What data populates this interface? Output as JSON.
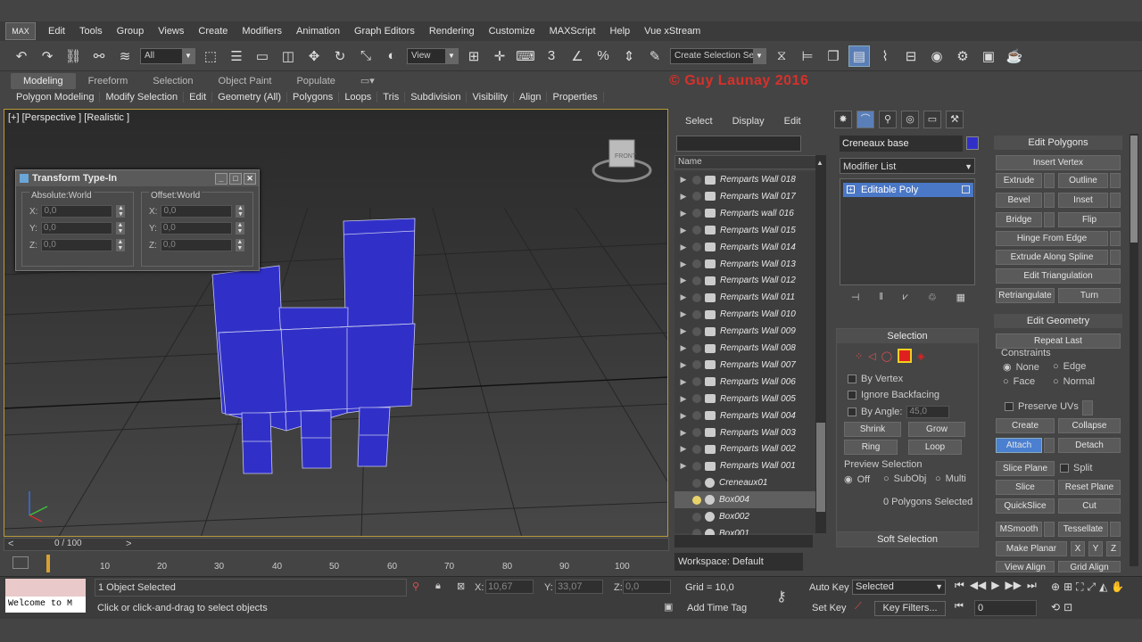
{
  "menubar": {
    "logo": "MAX",
    "items": [
      "Edit",
      "Tools",
      "Group",
      "Views",
      "Create",
      "Modifiers",
      "Animation",
      "Graph Editors",
      "Rendering",
      "Customize",
      "MAXScript",
      "Help",
      "Vue xStream"
    ]
  },
  "toolbar": {
    "filter_value": "All",
    "refcoord_value": "View",
    "selset_value": "Create Selection Se"
  },
  "ribbon": {
    "tabs": [
      "Modeling",
      "Freeform",
      "Selection",
      "Object Paint",
      "Populate"
    ],
    "subtabs": [
      "Polygon Modeling",
      "Modify Selection",
      "Edit",
      "Geometry (All)",
      "Polygons",
      "Loops",
      "Tris",
      "Subdivision",
      "Visibility",
      "Align",
      "Properties"
    ]
  },
  "watermark": "© Guy Launay 2016",
  "viewport": {
    "label": "[+] [Perspective ] [Realistic ]",
    "gizmo": "FRONT",
    "object_color": "#3030c8"
  },
  "transform_typein": {
    "title": "Transform Type-In",
    "absolute": {
      "title": "Absolute:World",
      "x": "0,0",
      "y": "0,0",
      "z": "0,0"
    },
    "offset": {
      "title": "Offset:World",
      "x": "0,0",
      "y": "0,0",
      "z": "0,0"
    },
    "axis_x": "X:",
    "axis_y": "Y:",
    "axis_z": "Z:"
  },
  "timeline": {
    "frame_label": "0 / 100",
    "ticks": [
      "10",
      "20",
      "30",
      "40",
      "50",
      "60",
      "70",
      "80",
      "90",
      "100"
    ]
  },
  "scene_explorer": {
    "tabs": [
      "Select",
      "Display",
      "Edit"
    ],
    "column": "Name",
    "items": [
      {
        "name": "Remparts Wall 018",
        "type": "group"
      },
      {
        "name": "Remparts Wall 017",
        "type": "group"
      },
      {
        "name": "Remparts wall 016",
        "type": "group"
      },
      {
        "name": "Remparts Wall 015",
        "type": "group"
      },
      {
        "name": "Remparts Wall 014",
        "type": "group"
      },
      {
        "name": "Remparts Wall 013",
        "type": "group"
      },
      {
        "name": "Remparts Wall 012",
        "type": "group"
      },
      {
        "name": "Remparts Wall 011",
        "type": "group"
      },
      {
        "name": "Remparts Wall 010",
        "type": "group"
      },
      {
        "name": "Remparts Wall 009",
        "type": "group"
      },
      {
        "name": "Remparts Wall 008",
        "type": "group"
      },
      {
        "name": "Remparts Wall 007",
        "type": "group"
      },
      {
        "name": "Remparts Wall 006",
        "type": "group"
      },
      {
        "name": "Remparts Wall 005",
        "type": "group"
      },
      {
        "name": "Remparts Wall 004",
        "type": "group"
      },
      {
        "name": "Remparts Wall 003",
        "type": "group"
      },
      {
        "name": "Remparts Wall 002",
        "type": "group"
      },
      {
        "name": "Remparts Wall 001",
        "type": "group"
      },
      {
        "name": "Creneaux01",
        "type": "object"
      },
      {
        "name": "Box004",
        "type": "object",
        "selected": true
      },
      {
        "name": "Box002",
        "type": "object"
      },
      {
        "name": "Box001",
        "type": "object"
      }
    ],
    "workspace": "Workspace: Default"
  },
  "command_panel": {
    "object_name": "Creneaux base",
    "modifier_list": "Modifier List",
    "stack_item": "Editable Poly",
    "selection": {
      "title": "Selection",
      "by_vertex": "By Vertex",
      "ignore_backfacing": "Ignore Backfacing",
      "by_angle": "By Angle:",
      "angle_value": "45,0",
      "shrink": "Shrink",
      "grow": "Grow",
      "ring": "Ring",
      "loop": "Loop",
      "preview_title": "Preview Selection",
      "preview_off": "Off",
      "preview_subobj": "SubObj",
      "preview_multi": "Multi",
      "status": "0 Polygons Selected"
    },
    "soft_selection": "Soft Selection"
  },
  "edit_polygons": {
    "title": "Edit Polygons",
    "insert_vertex": "Insert Vertex",
    "extrude": "Extrude",
    "outline": "Outline",
    "bevel": "Bevel",
    "inset": "Inset",
    "bridge": "Bridge",
    "flip": "Flip",
    "hinge": "Hinge From Edge",
    "extrude_spline": "Extrude Along Spline",
    "edit_tri": "Edit Triangulation",
    "retriangulate": "Retriangulate",
    "turn": "Turn"
  },
  "edit_geometry": {
    "title": "Edit Geometry",
    "repeat_last": "Repeat Last",
    "constraints": "Constraints",
    "none": "None",
    "edge": "Edge",
    "face": "Face",
    "normal": "Normal",
    "preserve_uvs": "Preserve UVs",
    "create": "Create",
    "collapse": "Collapse",
    "attach": "Attach",
    "detach": "Detach",
    "slice_plane": "Slice Plane",
    "split": "Split",
    "slice": "Slice",
    "reset_plane": "Reset Plane",
    "quickslice": "QuickSlice",
    "cut": "Cut",
    "msmooth": "MSmooth",
    "tessellate": "Tessellate",
    "make_planar": "Make Planar",
    "x": "X",
    "y": "Y",
    "z": "Z",
    "view_align": "View Align",
    "grid_align": "Grid Align"
  },
  "status": {
    "maxscript_text": "Welcome to M",
    "selected": "1 Object Selected",
    "prompt": "Click or click-and-drag to select objects",
    "x_label": "X:",
    "x_value": "10,67",
    "y_label": "Y:",
    "y_value": "33,07",
    "z_label": "Z:",
    "z_value": "0,0",
    "grid": "Grid = 10,0",
    "add_time_tag": "Add Time Tag",
    "auto_key": "Auto Key",
    "set_key": "Set Key",
    "selected_dropdown": "Selected",
    "key_filters": "Key Filters...",
    "frame_value": "0"
  }
}
